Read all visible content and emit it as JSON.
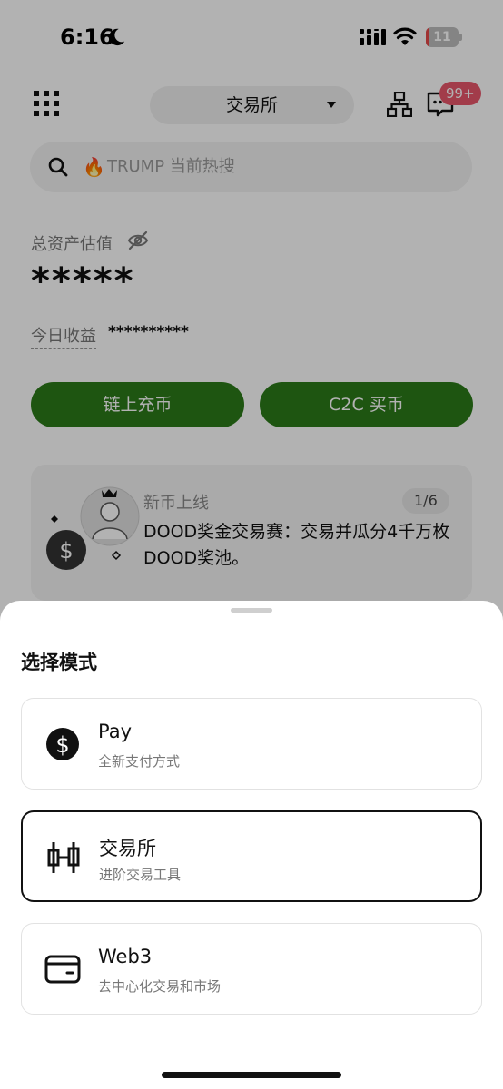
{
  "status_bar": {
    "time": "6:16",
    "battery": "11",
    "battery_level": 0.11,
    "battery_color": "#e54848"
  },
  "header": {
    "mode_label": "交易所",
    "badge": "99+"
  },
  "search": {
    "placeholder": "TRUMP 当前热搜"
  },
  "assets": {
    "label": "总资产估值",
    "value": "*****",
    "today_label": "今日收益",
    "today_value": "**********"
  },
  "actions": {
    "deposit": "链上充币",
    "c2c": "C2C 买币"
  },
  "news": {
    "tag": "新币上线",
    "pager": "1/6",
    "text": "DOOD奖金交易赛：交易并瓜分4千万枚DOOD奖池。"
  },
  "sheet": {
    "title": "选择模式",
    "options": [
      {
        "title": "Pay",
        "subtitle": "全新支付方式",
        "icon": "dollar-circle-icon",
        "selected": false
      },
      {
        "title": "交易所",
        "subtitle": "进阶交易工具",
        "icon": "candlestick-icon",
        "selected": true
      },
      {
        "title": "Web3",
        "subtitle": "去中心化交易和市场",
        "icon": "wallet-icon",
        "selected": false
      }
    ]
  },
  "colors": {
    "primary_green": "#2b7a19",
    "badge_red": "#e8566b",
    "fire": "#f06b1c"
  }
}
